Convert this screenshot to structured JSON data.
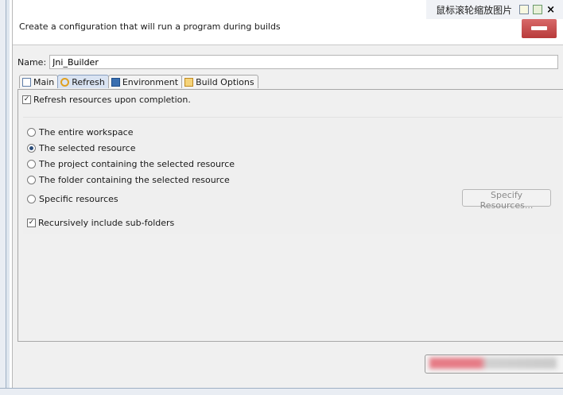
{
  "overlay": {
    "title": "鼠标滚轮缩放图片",
    "close": "×"
  },
  "header": {
    "description": "Create a configuration that will run a program during builds"
  },
  "name": {
    "label": "Name:",
    "value": "Jni_Builder"
  },
  "tabs": [
    {
      "label": "Main",
      "icon": "main-tab-icon"
    },
    {
      "label": "Refresh",
      "icon": "refresh-tab-icon"
    },
    {
      "label": "Environment",
      "icon": "environment-tab-icon"
    },
    {
      "label": "Build Options",
      "icon": "build-options-tab-icon"
    }
  ],
  "refresh": {
    "refresh_on_completion": {
      "label": "Refresh resources upon completion.",
      "checked": true
    },
    "scope_options": [
      {
        "label": "The entire workspace",
        "selected": false
      },
      {
        "label": "The selected resource",
        "selected": true
      },
      {
        "label": "The project containing the selected resource",
        "selected": false
      },
      {
        "label": "The folder containing the selected resource",
        "selected": false
      },
      {
        "label": "Specific resources",
        "selected": false
      }
    ],
    "specify_button": "Specify Resources...",
    "recursive": {
      "label": "Recursively include sub-folders",
      "checked": true
    }
  },
  "colors": {
    "accent": "#d9e3f2",
    "panel_bg": "#f0f0f0",
    "header_banner": "#c0404a"
  }
}
